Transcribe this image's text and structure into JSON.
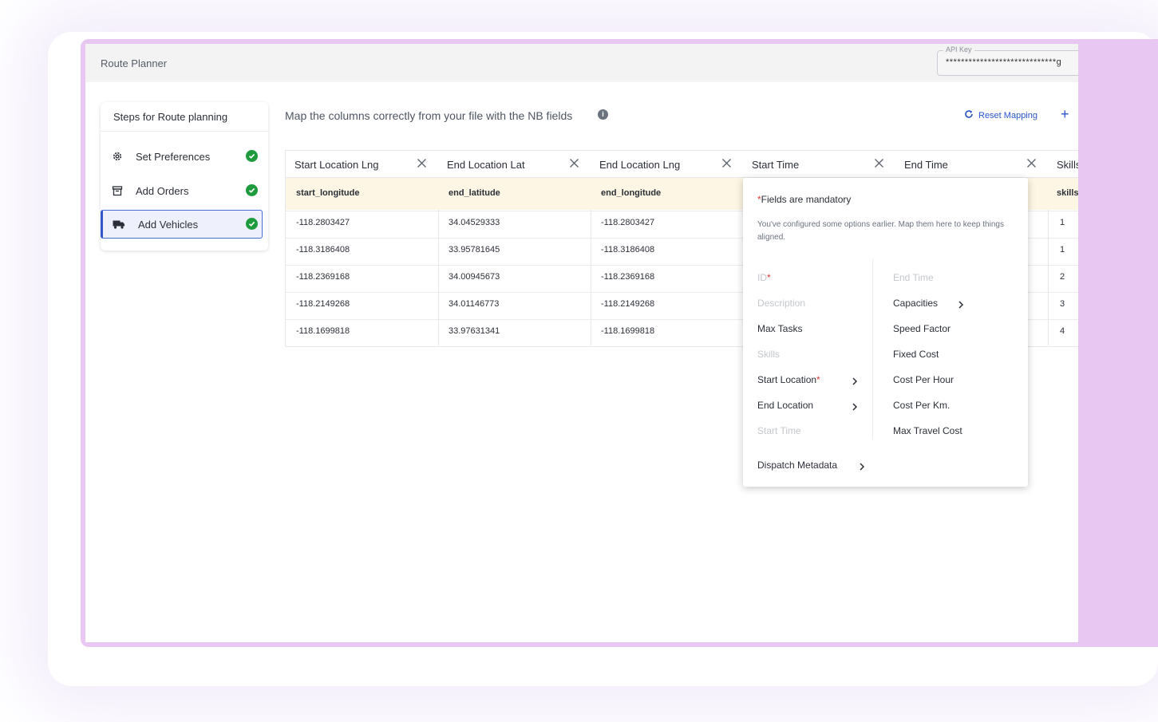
{
  "app": {
    "title": "Route Planner"
  },
  "api_key": {
    "label": "API Key",
    "value": "*****************************g"
  },
  "steps": {
    "title": "Steps for Route planning",
    "items": [
      {
        "label": "Set Preferences",
        "icon": "gear-icon",
        "status": "complete"
      },
      {
        "label": "Add Orders",
        "icon": "archive-icon",
        "status": "complete"
      },
      {
        "label": "Add Vehicles",
        "icon": "truck-icon",
        "status": "complete",
        "active": true
      }
    ]
  },
  "mapping": {
    "heading": "Map the columns correctly from your file with the NB fields",
    "reset_label": "Reset Mapping"
  },
  "table": {
    "columns": [
      {
        "header": "Start Location Lng",
        "mapped": "start_longitude",
        "values": [
          "-118.2803427",
          "-118.3186408",
          "-118.2369168",
          "-118.2149268",
          "-118.1699818"
        ]
      },
      {
        "header": "End Location Lat",
        "mapped": "end_latitude",
        "values": [
          "34.04529333",
          "33.95781645",
          "34.00945673",
          "34.01146773",
          "33.97631341"
        ]
      },
      {
        "header": "End Location Lng",
        "mapped": "end_longitude",
        "values": [
          "-118.2803427",
          "-118.3186408",
          "-118.2369168",
          "-118.2149268",
          "-118.1699818"
        ]
      },
      {
        "header": "Start Time",
        "mapped": "",
        "values": [
          "",
          "",
          "",
          "",
          ""
        ]
      },
      {
        "header": "End Time",
        "mapped": "",
        "values": [
          "",
          "",
          "",
          "",
          ""
        ]
      },
      {
        "header": "Skills",
        "mapped": "skills",
        "values": [
          "1",
          "1",
          "2",
          "3",
          "4"
        ]
      }
    ]
  },
  "dropdown": {
    "mandatory_star": "*",
    "mandatory_text": "Fields are mandatory",
    "note": "You've configured some options earlier. Map them here to keep things aligned.",
    "left_items": [
      {
        "label": "ID",
        "required": true,
        "disabled": true
      },
      {
        "label": "Description",
        "disabled": true
      },
      {
        "label": "Max Tasks"
      },
      {
        "label": "Skills",
        "disabled": true
      },
      {
        "label": "Start Location",
        "required": true,
        "submenu": true
      },
      {
        "label": "End Location",
        "submenu": true
      },
      {
        "label": "Start Time",
        "disabled": true
      }
    ],
    "right_items": [
      {
        "label": "End Time",
        "disabled": true
      },
      {
        "label": "Capacities",
        "submenu": true
      },
      {
        "label": "Speed Factor"
      },
      {
        "label": "Fixed Cost"
      },
      {
        "label": "Cost Per Hour"
      },
      {
        "label": "Cost Per Km."
      },
      {
        "label": "Max Travel Cost"
      }
    ],
    "footer_item": {
      "label": "Dispatch Metadata",
      "submenu": true
    }
  },
  "colors": {
    "accent": "#2955c9",
    "success": "#1e9b3d",
    "required": "#e03a3a",
    "mapped_row_bg": "#fdf6e4"
  }
}
